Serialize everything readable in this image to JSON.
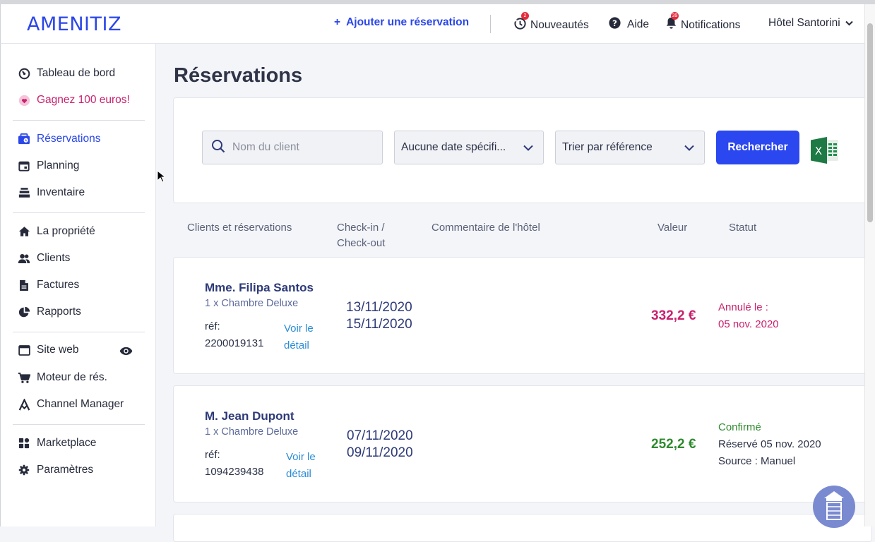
{
  "topbar": {
    "logo": "AMENITIZ",
    "add_reservation": "Ajouter une réservation",
    "news": "Nouveautés",
    "news_badge": "2",
    "help": "Aide",
    "notifications": "Notifications",
    "notifications_badge": "39",
    "hotel": "Hôtel Santorini"
  },
  "sidebar": {
    "items": [
      {
        "label": "Tableau de bord",
        "icon": "gauge-icon"
      },
      {
        "label": "Gagnez 100 euros!",
        "icon": "heart-icon"
      },
      {
        "label": "Réservations",
        "icon": "reservations-icon"
      },
      {
        "label": "Planning",
        "icon": "calendar-icon"
      },
      {
        "label": "Inventaire",
        "icon": "inventory-icon"
      },
      {
        "label": "La propriété",
        "icon": "home-icon"
      },
      {
        "label": "Clients",
        "icon": "users-icon"
      },
      {
        "label": "Factures",
        "icon": "invoice-icon"
      },
      {
        "label": "Rapports",
        "icon": "pie-chart-icon"
      },
      {
        "label": "Site web",
        "icon": "browser-icon"
      },
      {
        "label": "Moteur de rés.",
        "icon": "cart-icon"
      },
      {
        "label": "Channel Manager",
        "icon": "channel-icon"
      },
      {
        "label": "Marketplace",
        "icon": "apps-icon"
      },
      {
        "label": "Paramètres",
        "icon": "gear-icon"
      }
    ]
  },
  "page": {
    "title": "Réservations"
  },
  "filters": {
    "search_placeholder": "Nom du client",
    "date_select": "Aucune date spécifi...",
    "sort_select": "Trier par référence",
    "search_button": "Rechercher"
  },
  "table": {
    "headers": [
      "Clients et réservations",
      "Check-in /",
      "Check-out",
      "Commentaire de l'hôtel",
      "Valeur",
      "Statut"
    ]
  },
  "reservations": [
    {
      "guest": "Mme. Filipa Santos",
      "room": "1 x Chambre Deluxe",
      "ref_label": "réf:",
      "ref": "2200019131",
      "detail_line1": "Voir le",
      "detail_line2": "détail",
      "checkin": "13/11/2020",
      "checkout": "15/11/2020",
      "value": "332,2 €",
      "status_line1": "Annulé le :",
      "status_line2": "05 nov. 2020",
      "status_line3": "",
      "value_color": "#c8216d"
    },
    {
      "guest": "M. Jean Dupont",
      "room": "1 x Chambre Deluxe",
      "ref_label": "réf:",
      "ref": "1094239438",
      "detail_line1": "Voir le",
      "detail_line2": "détail",
      "checkin": "07/11/2020",
      "checkout": "09/11/2020",
      "value": "252,2 €",
      "status_line1": "Confirmé",
      "status_line2": "Réservé 05 nov. 2020",
      "status_line3": "Source : Manuel",
      "value_color": "#2e8b2e"
    }
  ],
  "colors": {
    "accent": "#2b47e8",
    "cancelled": "#c8216d",
    "confirmed": "#2e8b2e"
  }
}
